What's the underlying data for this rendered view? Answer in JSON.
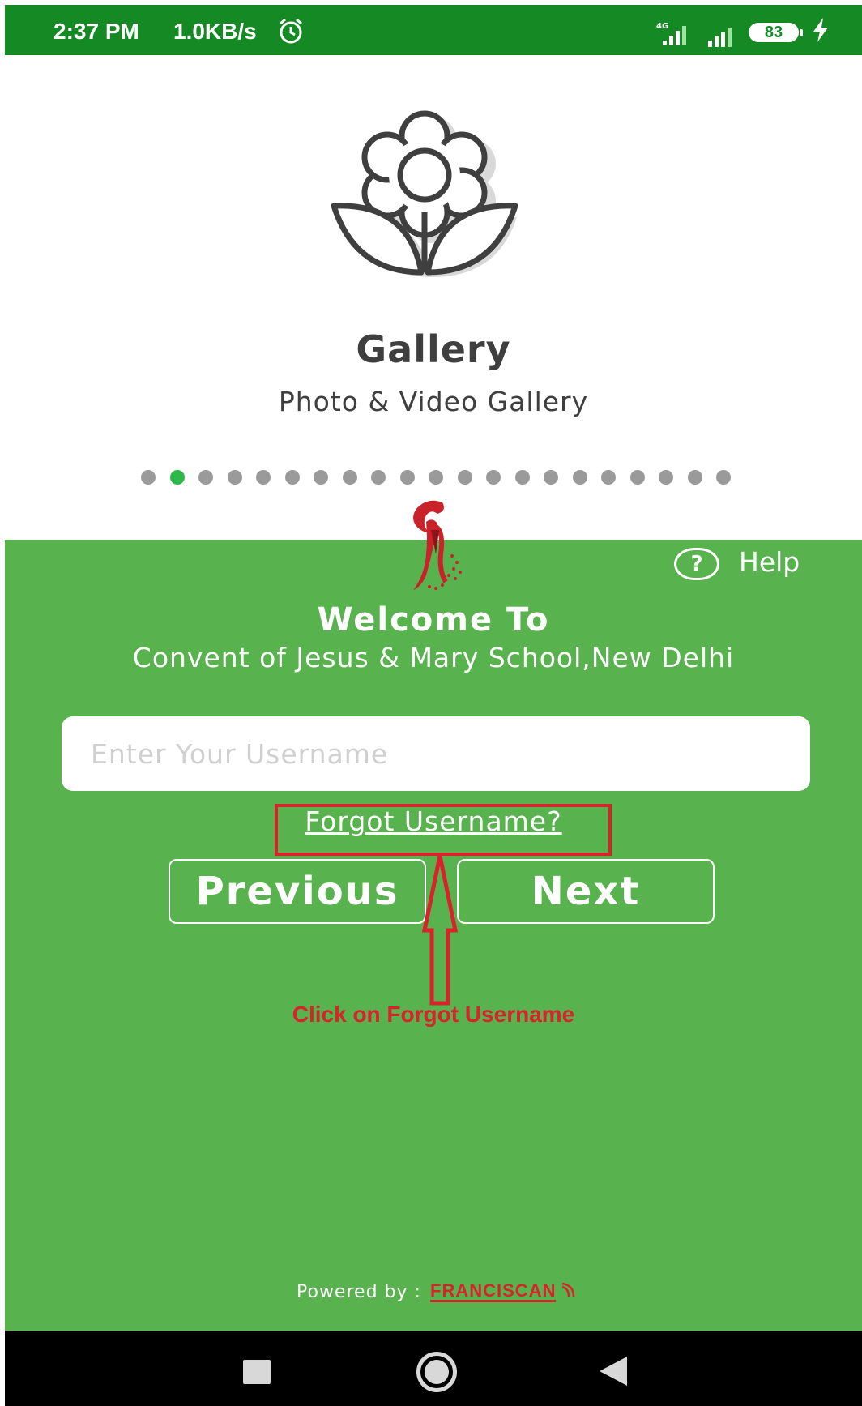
{
  "status_bar": {
    "time": "2:37 PM",
    "network_speed": "1.0KB/s",
    "network_type": "4G",
    "battery_level": "83"
  },
  "gallery": {
    "title": "Gallery",
    "subtitle": "Photo & Video Gallery"
  },
  "pager": {
    "total": 21,
    "active_index": 1
  },
  "help": {
    "label": "Help",
    "icon_glyph": "?"
  },
  "welcome": {
    "heading": "Welcome To",
    "school": "Convent of Jesus & Mary School,New Delhi"
  },
  "login": {
    "username_placeholder": "Enter Your Username",
    "username_value": "",
    "forgot_label": "Forgot Username?",
    "previous_label": "Previous",
    "next_label": "Next"
  },
  "annotation": {
    "text": "Click on Forgot Username"
  },
  "footer": {
    "powered_by": "Powered by :",
    "brand": "FRANCISCAN"
  },
  "colors": {
    "status_bar": "#158a24",
    "panel": "#58b24e",
    "accent_dot": "#2fb84a",
    "annotation_red": "#d8232a"
  }
}
